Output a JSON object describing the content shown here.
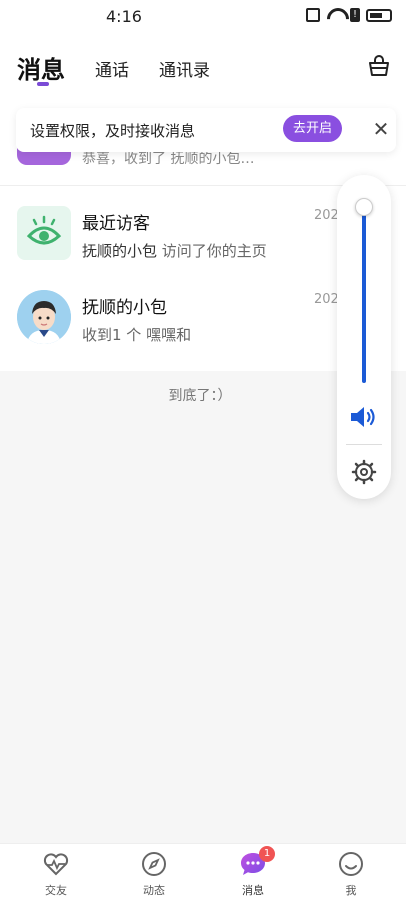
{
  "status": {
    "time": "4:16",
    "alert_glyph": "!"
  },
  "header": {
    "tabs": [
      "消息",
      "通话",
      "通讯录"
    ],
    "active_tab": "消息",
    "accent_color": "#7b4bd6"
  },
  "banner": {
    "text": "设置权限，及时接收消息",
    "button": "去开启",
    "close_symbol": "✕",
    "button_color": "#8a4fe0"
  },
  "partial_item": {
    "subtitle": "恭喜，收到了 抚顺的小包…"
  },
  "items": [
    {
      "title": "最近访客",
      "subtitle_name": "抚顺的小包",
      "subtitle_rest": " 访问了你的主页",
      "time": "202"
    },
    {
      "title": "抚顺的小包",
      "subtitle": "收到1 个 嘿嘿和",
      "time": "202"
    }
  ],
  "list_end": "到底了：）",
  "volume_panel": {
    "level": 1.0,
    "color": "#1b5ad6"
  },
  "bottom_nav": {
    "items": [
      {
        "label": "交友",
        "icon": "heart-pulse-icon"
      },
      {
        "label": "动态",
        "icon": "compass-icon"
      },
      {
        "label": "消息",
        "icon": "chat-bubble-icon",
        "badge": "1"
      },
      {
        "label": "我",
        "icon": "smile-icon"
      }
    ]
  }
}
